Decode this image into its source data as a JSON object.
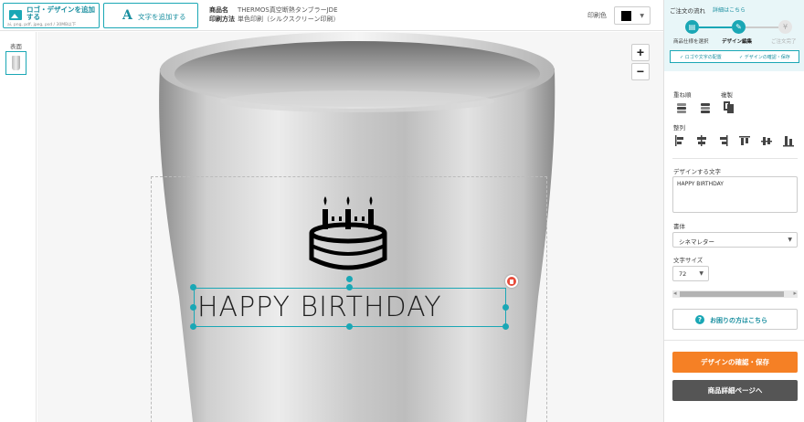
{
  "toolbar": {
    "logo_button_label": "ロゴ・デザインを追加する",
    "logo_button_sub": "ai, png, pdf, jpeg, psd / 30MB以下",
    "text_button_label": "文字を追加する",
    "text_button_icon": "A",
    "product_key": "商品名",
    "product_value": "THERMOS真空断熱タンブラーJDE",
    "print_key": "印刷方法",
    "print_value": "単色印刷（シルクスクリーン印刷）",
    "color_label": "印刷色",
    "color_value": "#000000"
  },
  "sidebar_left": {
    "face_label": "表面"
  },
  "canvas": {
    "zoom_in": "+",
    "zoom_out": "−",
    "design_text": "HAPPY BIRTHDAY"
  },
  "panel": {
    "flow_title": "ご注文の流れ",
    "flow_link": "詳細はこちら",
    "steps": [
      {
        "label": "商品仕様を選択",
        "state": "done"
      },
      {
        "label": "デザイン編集",
        "state": "current"
      },
      {
        "label": "ご注文完了",
        "state": "todo"
      }
    ],
    "substeps": [
      "✓ ロゴや文字の配置",
      "✓ デザインの確認・保存"
    ],
    "order_label": "重ね順",
    "copy_label": "複製",
    "align_label": "整列",
    "text_label": "デザインする文字",
    "text_value": "HAPPY BIRTHDAY",
    "font_label": "書体",
    "font_value": "シネマレター",
    "size_label": "文字サイズ",
    "size_value": "72",
    "help_label": "お困りの方はこちら",
    "confirm_label": "デザインの確認・保存",
    "detail_label": "商品詳細ページへ"
  },
  "colors": {
    "accent": "#1aa7b5",
    "orange": "#f58025",
    "dark": "#555555",
    "delete": "#e74c3c"
  }
}
